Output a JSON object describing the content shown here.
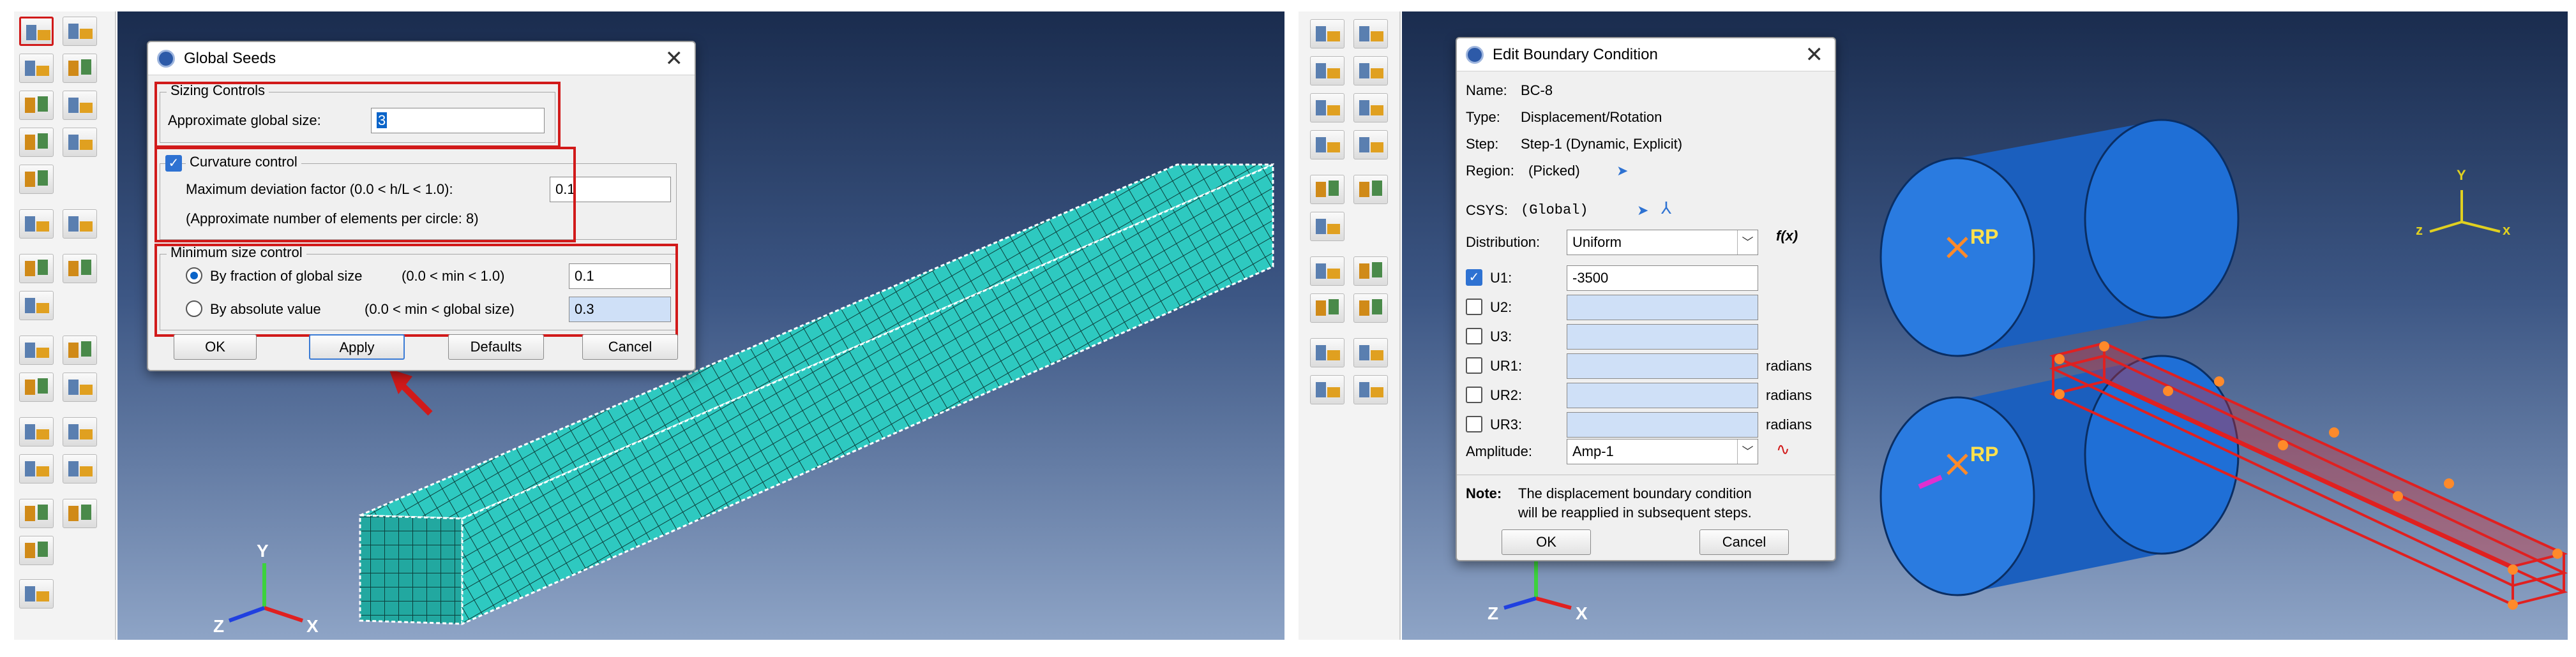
{
  "left": {
    "dialog": {
      "title": "Global Seeds",
      "close": "✕",
      "sizing": {
        "title": "Sizing Controls",
        "label": "Approximate global size:",
        "value": "3"
      },
      "curvature": {
        "title": "Curvature control",
        "deviation_label": "Maximum deviation factor (0.0 < h/L < 1.0):",
        "deviation_value": "0.1",
        "note": "(Approximate number of elements per circle: 8)"
      },
      "min_size": {
        "title": "Minimum size control",
        "fraction_label": "By fraction of global size",
        "fraction_range": "(0.0 < min < 1.0)",
        "fraction_value": "0.1",
        "absolute_label": "By absolute value",
        "absolute_range": "(0.0 < min < global size)",
        "absolute_value": "0.3"
      },
      "buttons": {
        "ok": "OK",
        "apply": "Apply",
        "defaults": "Defaults",
        "cancel": "Cancel"
      }
    },
    "triad": {
      "x": "X",
      "y": "Y",
      "z": "Z"
    }
  },
  "right": {
    "dialog": {
      "title": "Edit Boundary Condition",
      "close": "✕",
      "name_label": "Name:",
      "name_value": "BC-8",
      "type_label": "Type:",
      "type_value": "Displacement/Rotation",
      "step_label": "Step:",
      "step_value": "Step-1 (Dynamic, Explicit)",
      "region_label": "Region:",
      "region_value": "(Picked)",
      "csys_label": "CSYS:",
      "csys_value": "(Global)",
      "distribution_label": "Distribution:",
      "distribution_value": "Uniform",
      "fx": "f(x)",
      "dofs": [
        {
          "label": "U1:",
          "checked": true,
          "value": "-3500",
          "unit": ""
        },
        {
          "label": "U2:",
          "checked": false,
          "value": "",
          "unit": ""
        },
        {
          "label": "U3:",
          "checked": false,
          "value": "",
          "unit": ""
        },
        {
          "label": "UR1:",
          "checked": false,
          "value": "",
          "unit": "radians"
        },
        {
          "label": "UR2:",
          "checked": false,
          "value": "",
          "unit": "radians"
        },
        {
          "label": "UR3:",
          "checked": false,
          "value": "",
          "unit": "radians"
        }
      ],
      "amplitude_label": "Amplitude:",
      "amplitude_value": "Amp-1",
      "note_label": "Note:",
      "note_line1": "The displacement boundary condition",
      "note_line2": "will be reapplied in subsequent steps.",
      "buttons": {
        "ok": "OK",
        "cancel": "Cancel"
      }
    },
    "rp1": "RP",
    "rp2": "RP",
    "triad": {
      "x": "X",
      "y": "Y",
      "z": "Z"
    },
    "triad_small": {
      "x": "x",
      "y": "Y",
      "z": "z"
    }
  },
  "colors": {
    "viewport_top": "#1a2c4e",
    "viewport_bottom": "#8ea4c6",
    "mesh": "#2ec9c0",
    "roller": "#1f6fd6",
    "highlight_red": "#d11a1a",
    "rp_yellow": "#ffe14d"
  },
  "icons": [
    "seed-part-icon",
    "arrow-pointer-icon",
    "mesh-tool-icon",
    "check-icon",
    "xyz-query-icon",
    "axis-triad-icon",
    "pick-cursor-icon",
    "csys-icon",
    "amplitude-wave-icon",
    "function-icon"
  ]
}
